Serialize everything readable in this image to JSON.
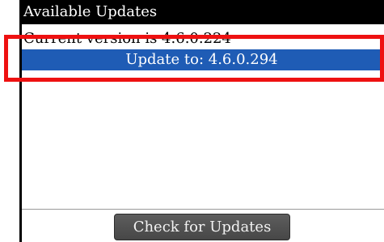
{
  "title": "Available Updates",
  "current_version_text": "Current version is 4.6.0.224",
  "update_item": "Update to: 4.6.0.294",
  "check_button_label": "Check for Updates",
  "colors": {
    "title_bg": "#000000",
    "selected_bg": "#1f5cb5",
    "annotation": "#ee1111"
  }
}
